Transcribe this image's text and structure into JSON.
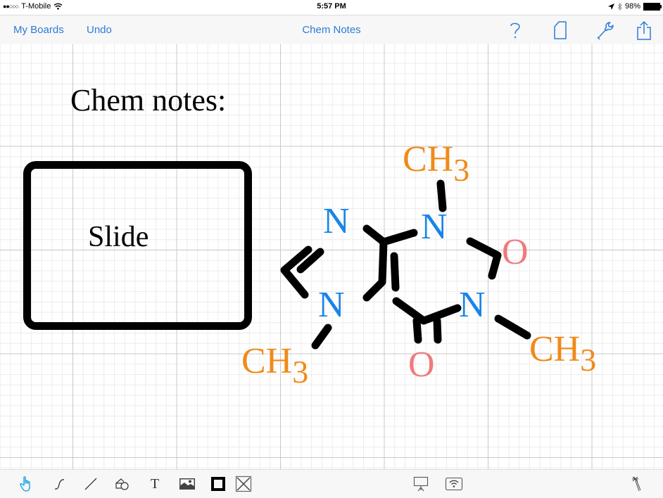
{
  "status_bar": {
    "signal": "●●○○○",
    "carrier": "T-Mobile",
    "time": "5:57 PM",
    "battery_percent": "98%",
    "icons": [
      "wifi-icon",
      "location-arrow-icon",
      "bluetooth-icon",
      "battery-icon"
    ]
  },
  "nav": {
    "left_buttons": [
      {
        "label": "My Boards"
      },
      {
        "label": "Undo"
      }
    ],
    "title": "Chem Notes",
    "right_icons": [
      "help-icon",
      "page-icon",
      "wrench-icon",
      "share-icon"
    ]
  },
  "canvas": {
    "heading": "Chem notes:",
    "slide_label": "Slide",
    "molecule": {
      "atoms": [
        {
          "symbol": "N",
          "element": "nitrogen"
        },
        {
          "symbol": "N",
          "element": "nitrogen"
        },
        {
          "symbol": "N",
          "element": "nitrogen"
        },
        {
          "symbol": "N",
          "element": "nitrogen"
        },
        {
          "symbol": "O",
          "element": "oxygen"
        },
        {
          "symbol": "O",
          "element": "oxygen"
        },
        {
          "symbol": "CH",
          "subscript": "3",
          "element": "methyl"
        },
        {
          "symbol": "CH",
          "subscript": "3",
          "element": "methyl"
        },
        {
          "symbol": "CH",
          "subscript": "3",
          "element": "methyl"
        }
      ],
      "colors": {
        "nitrogen": "#1a84e8",
        "oxygen": "#f07a7e",
        "methyl": "#f08a1a",
        "bond": "#000000"
      }
    }
  },
  "toolbar": {
    "active_tool": "hand",
    "active_color": "#29a8e0",
    "tools": [
      "hand-tool",
      "freehand-tool",
      "line-tool",
      "shapes-tool",
      "text-tool",
      "image-tool",
      "frame-tool",
      "placeholder-tool"
    ],
    "text_tool_glyph": "T",
    "right_tools": [
      "present-tool",
      "broadcast-tool",
      "magic-wand-tool"
    ]
  }
}
